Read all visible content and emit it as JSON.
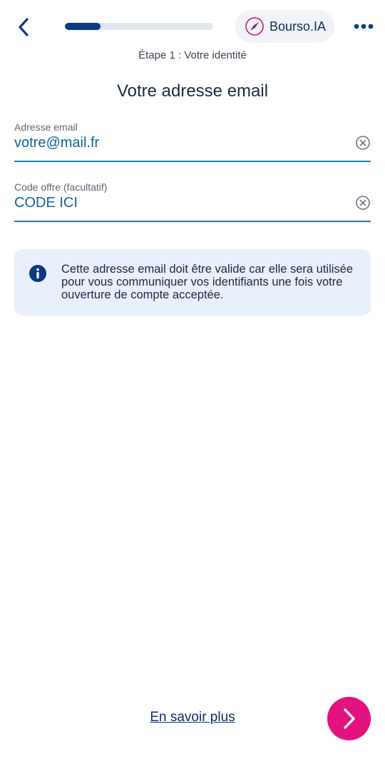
{
  "header": {
    "back_icon": "chevron-left-icon",
    "progress_fraction": 0.24,
    "assistant_label": "Bourso.IA",
    "assistant_icon": "compass-star-icon",
    "more_icon": "more-dots-icon",
    "step_label": "Étape 1 : Votre identité"
  },
  "page": {
    "title": "Votre adresse email"
  },
  "form": {
    "email": {
      "label": "Adresse email",
      "value": "votre@mail.fr",
      "clear_icon": "clear-circle-icon"
    },
    "offer_code": {
      "label": "Code offre (facultatif)",
      "value": "CODE ICI",
      "clear_icon": "clear-circle-icon"
    }
  },
  "info": {
    "icon": "info-icon",
    "text": "Cette adresse email doit être valide car elle sera utilisée pour vous communiquer vos identifiants une fois votre ouverture de compte acceptée."
  },
  "footer": {
    "learn_more": "En savoir plus",
    "next_icon": "chevron-right-icon"
  },
  "colors": {
    "primary": "#0d3b82",
    "accent": "#e3127f",
    "field_line": "#1b7fb0",
    "info_bg": "#e7f0fc"
  }
}
